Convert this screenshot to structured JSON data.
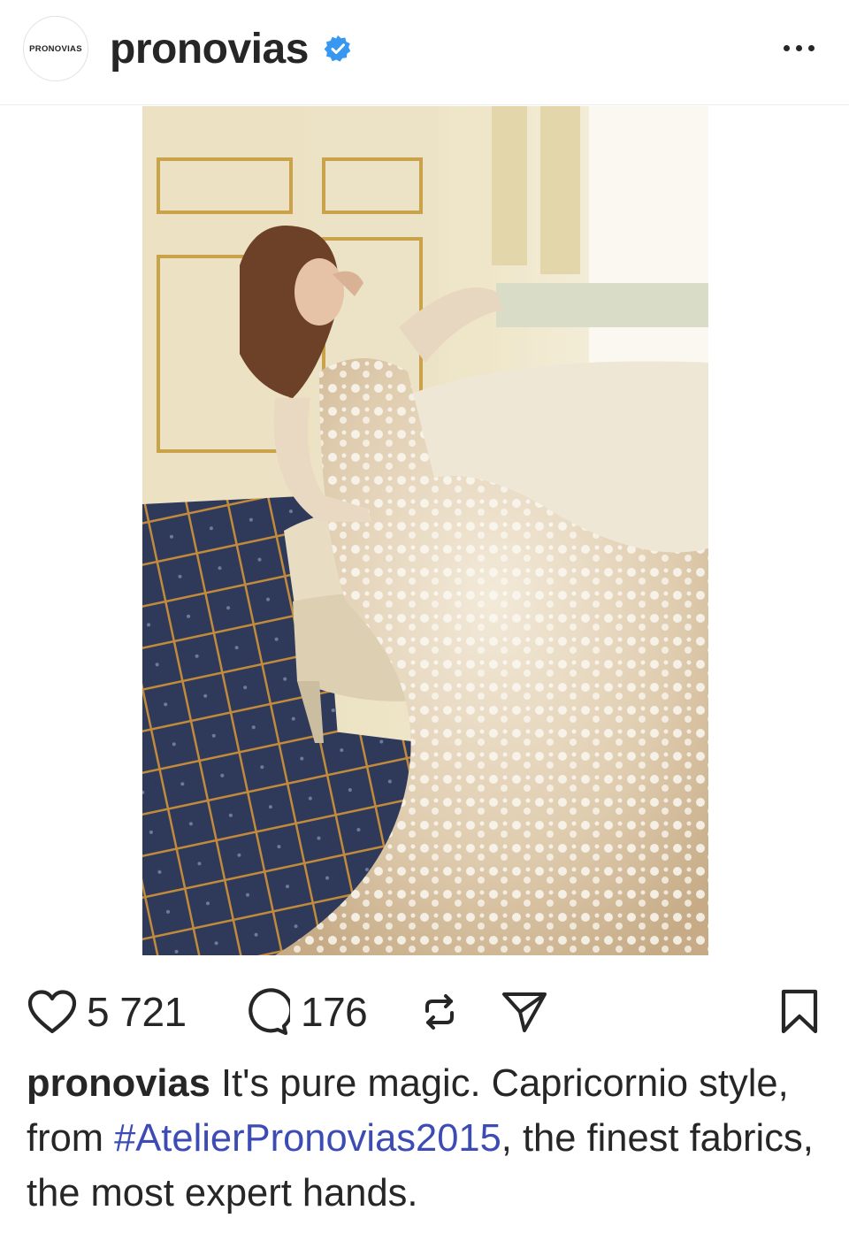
{
  "post": {
    "account": {
      "username": "pronovias",
      "avatar_text": "PRONOVIAS",
      "verified": true,
      "verified_color": "#3897f0"
    },
    "header_menu_icon": "more-horizontal-icon",
    "image": {
      "description_icon": "photo",
      "has_tagged_users": true
    },
    "actions": {
      "likes": "5 721",
      "comments": "176",
      "icons": [
        "heart-icon",
        "comment-icon",
        "repost-icon",
        "share-icon",
        "bookmark-icon"
      ]
    },
    "caption": {
      "username": "pronovias",
      "text_before": " It's pure magic. Capricornio style, from ",
      "hashtag": "#AtelierPronovias2015",
      "text_after": ", the finest fabrics, the most expert hands.",
      "hashtag_color": "#3d4bb5"
    }
  }
}
